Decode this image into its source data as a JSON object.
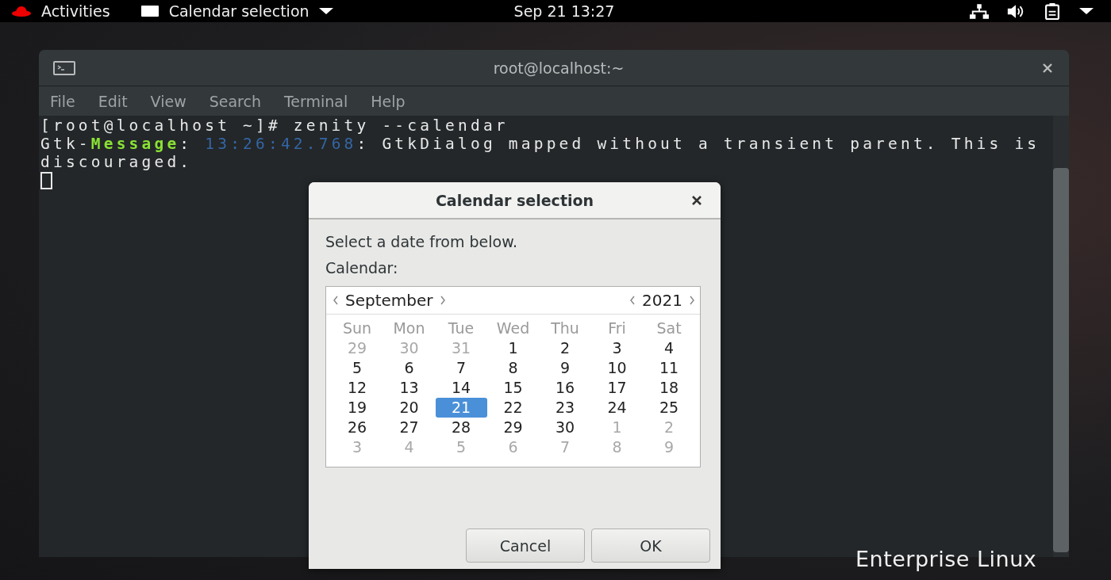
{
  "top_bar": {
    "activities": "Activities",
    "app_menu": "Calendar selection",
    "clock": "Sep 21  13:27"
  },
  "terminal": {
    "title": "root@localhost:~",
    "menu": [
      "File",
      "Edit",
      "View",
      "Search",
      "Terminal",
      "Help"
    ],
    "lines": [
      [
        {
          "kind": "plain",
          "text": "[root@localhost ~]# zenity --calendar"
        }
      ],
      [
        {
          "kind": "plain",
          "text": "Gtk-"
        },
        {
          "kind": "keyword",
          "text": "Message"
        },
        {
          "kind": "plain",
          "text": ": "
        },
        {
          "kind": "time",
          "text": "13:26:42.768"
        },
        {
          "kind": "plain",
          "text": ": GtkDialog mapped without a transient parent. This is"
        }
      ],
      [
        {
          "kind": "plain",
          "text": "discouraged."
        }
      ]
    ]
  },
  "dialog": {
    "title": "Calendar selection",
    "prompt": "Select a date from below.",
    "calendar_label": "Calendar:",
    "calendar": {
      "month": "September",
      "year": "2021",
      "weekdays": [
        "Sun",
        "Mon",
        "Tue",
        "Wed",
        "Thu",
        "Fri",
        "Sat"
      ],
      "weeks": [
        [
          {
            "day": "29",
            "other_month": true,
            "selected": false
          },
          {
            "day": "30",
            "other_month": true,
            "selected": false
          },
          {
            "day": "31",
            "other_month": true,
            "selected": false
          },
          {
            "day": "1",
            "other_month": false,
            "selected": false
          },
          {
            "day": "2",
            "other_month": false,
            "selected": false
          },
          {
            "day": "3",
            "other_month": false,
            "selected": false
          },
          {
            "day": "4",
            "other_month": false,
            "selected": false
          }
        ],
        [
          {
            "day": "5",
            "other_month": false,
            "selected": false
          },
          {
            "day": "6",
            "other_month": false,
            "selected": false
          },
          {
            "day": "7",
            "other_month": false,
            "selected": false
          },
          {
            "day": "8",
            "other_month": false,
            "selected": false
          },
          {
            "day": "9",
            "other_month": false,
            "selected": false
          },
          {
            "day": "10",
            "other_month": false,
            "selected": false
          },
          {
            "day": "11",
            "other_month": false,
            "selected": false
          }
        ],
        [
          {
            "day": "12",
            "other_month": false,
            "selected": false
          },
          {
            "day": "13",
            "other_month": false,
            "selected": false
          },
          {
            "day": "14",
            "other_month": false,
            "selected": false
          },
          {
            "day": "15",
            "other_month": false,
            "selected": false
          },
          {
            "day": "16",
            "other_month": false,
            "selected": false
          },
          {
            "day": "17",
            "other_month": false,
            "selected": false
          },
          {
            "day": "18",
            "other_month": false,
            "selected": false
          }
        ],
        [
          {
            "day": "19",
            "other_month": false,
            "selected": false
          },
          {
            "day": "20",
            "other_month": false,
            "selected": false
          },
          {
            "day": "21",
            "other_month": false,
            "selected": true
          },
          {
            "day": "22",
            "other_month": false,
            "selected": false
          },
          {
            "day": "23",
            "other_month": false,
            "selected": false
          },
          {
            "day": "24",
            "other_month": false,
            "selected": false
          },
          {
            "day": "25",
            "other_month": false,
            "selected": false
          }
        ],
        [
          {
            "day": "26",
            "other_month": false,
            "selected": false
          },
          {
            "day": "27",
            "other_month": false,
            "selected": false
          },
          {
            "day": "28",
            "other_month": false,
            "selected": false
          },
          {
            "day": "29",
            "other_month": false,
            "selected": false
          },
          {
            "day": "30",
            "other_month": false,
            "selected": false
          },
          {
            "day": "1",
            "other_month": true,
            "selected": false
          },
          {
            "day": "2",
            "other_month": true,
            "selected": false
          }
        ],
        [
          {
            "day": "3",
            "other_month": true,
            "selected": false
          },
          {
            "day": "4",
            "other_month": true,
            "selected": false
          },
          {
            "day": "5",
            "other_month": true,
            "selected": false
          },
          {
            "day": "6",
            "other_month": true,
            "selected": false
          },
          {
            "day": "7",
            "other_month": true,
            "selected": false
          },
          {
            "day": "8",
            "other_month": true,
            "selected": false
          },
          {
            "day": "9",
            "other_month": true,
            "selected": false
          }
        ]
      ]
    },
    "buttons": [
      "Cancel",
      "OK"
    ]
  },
  "desktop_text": "Enterprise Linux"
}
